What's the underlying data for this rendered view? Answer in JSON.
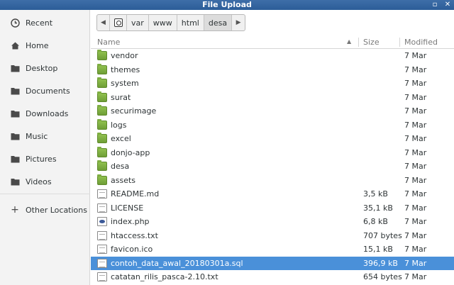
{
  "window": {
    "title": "File Upload",
    "restore_glyph": "▫",
    "close_glyph": "✕"
  },
  "sidebar": {
    "items": [
      {
        "label": "Recent",
        "icon": "clock-icon"
      },
      {
        "label": "Home",
        "icon": "home-icon"
      },
      {
        "label": "Desktop",
        "icon": "folder-icon"
      },
      {
        "label": "Documents",
        "icon": "folder-icon"
      },
      {
        "label": "Downloads",
        "icon": "folder-icon"
      },
      {
        "label": "Music",
        "icon": "folder-icon"
      },
      {
        "label": "Pictures",
        "icon": "folder-icon"
      },
      {
        "label": "Videos",
        "icon": "folder-icon"
      }
    ],
    "other": {
      "label": "Other Locations",
      "glyph": "+"
    }
  },
  "pathbar": {
    "back_glyph": "◀",
    "forward_glyph": "▶",
    "segments": [
      "var",
      "www",
      "html",
      "desa"
    ],
    "active": "desa"
  },
  "columns": {
    "name": "Name",
    "size": "Size",
    "modified": "Modified",
    "sort_glyph": "▲"
  },
  "files": [
    {
      "name": "vendor",
      "size": "",
      "modified": "7 Mar",
      "type": "folder"
    },
    {
      "name": "themes",
      "size": "",
      "modified": "7 Mar",
      "type": "folder"
    },
    {
      "name": "system",
      "size": "",
      "modified": "7 Mar",
      "type": "folder"
    },
    {
      "name": "surat",
      "size": "",
      "modified": "7 Mar",
      "type": "folder"
    },
    {
      "name": "securimage",
      "size": "",
      "modified": "7 Mar",
      "type": "folder"
    },
    {
      "name": "logs",
      "size": "",
      "modified": "7 Mar",
      "type": "folder"
    },
    {
      "name": "excel",
      "size": "",
      "modified": "7 Mar",
      "type": "folder"
    },
    {
      "name": "donjo-app",
      "size": "",
      "modified": "7 Mar",
      "type": "folder"
    },
    {
      "name": "desa",
      "size": "",
      "modified": "7 Mar",
      "type": "folder"
    },
    {
      "name": "assets",
      "size": "",
      "modified": "7 Mar",
      "type": "folder"
    },
    {
      "name": "README.md",
      "size": "3,5 kB",
      "modified": "7 Mar",
      "type": "doc"
    },
    {
      "name": "LICENSE",
      "size": "35,1 kB",
      "modified": "7 Mar",
      "type": "doc"
    },
    {
      "name": "index.php",
      "size": "6,8 kB",
      "modified": "7 Mar",
      "type": "php"
    },
    {
      "name": "htaccess.txt",
      "size": "707 bytes",
      "modified": "7 Mar",
      "type": "doc"
    },
    {
      "name": "favicon.ico",
      "size": "15,1 kB",
      "modified": "7 Mar",
      "type": "doc"
    },
    {
      "name": "contoh_data_awal_20180301a.sql",
      "size": "396,9 kB",
      "modified": "7 Mar",
      "type": "doc",
      "selected": true
    },
    {
      "name": "catatan_rilis_pasca-2.10.txt",
      "size": "654 bytes",
      "modified": "7 Mar",
      "type": "doc"
    }
  ],
  "colors": {
    "selection": "#4a90d9",
    "folder": "#7fae42",
    "titlebar": "#3e6ea8"
  }
}
